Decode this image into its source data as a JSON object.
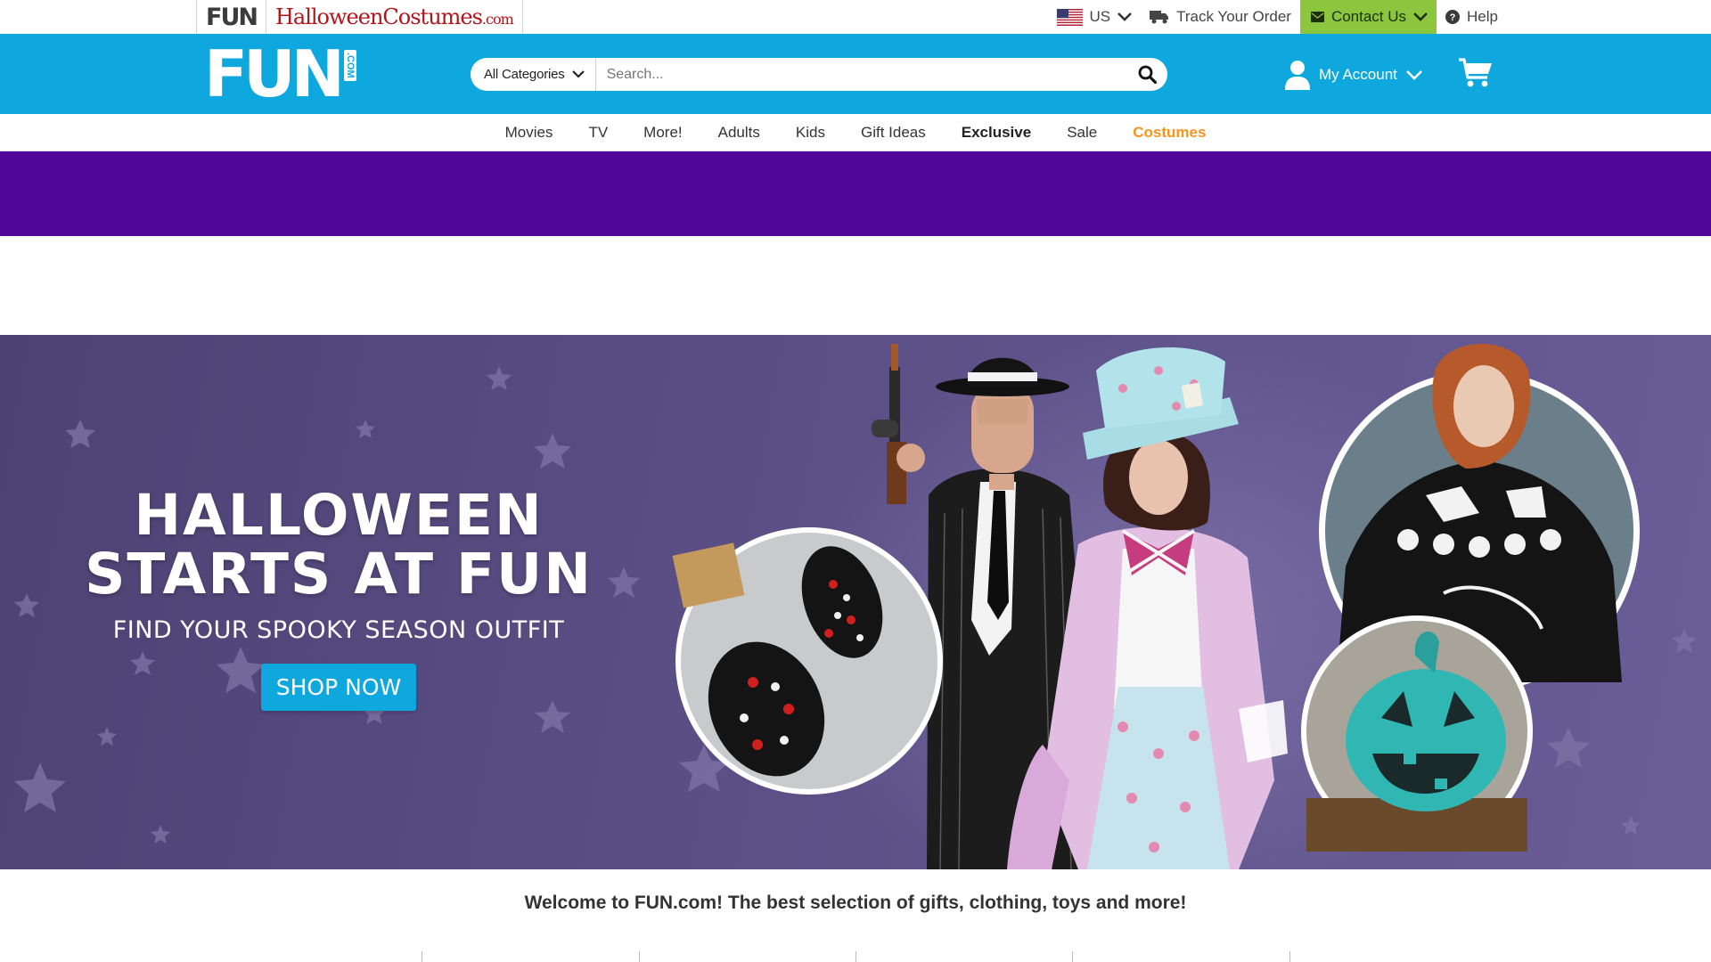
{
  "utility": {
    "sites": [
      {
        "name": "FUN"
      },
      {
        "name": "HalloweenCostumes",
        "tld": ".com"
      }
    ],
    "region": "US",
    "track_order": "Track Your Order",
    "contact": "Contact Us",
    "help": "Help"
  },
  "header": {
    "logo_text": "FUN",
    "logo_suffix": ".COM",
    "category_select": "All Categories",
    "search_placeholder": "Search...",
    "account_label": "My Account"
  },
  "nav": {
    "items": [
      "Movies",
      "TV",
      "More!",
      "Adults",
      "Kids",
      "Gift Ideas",
      "Exclusive",
      "Sale",
      "Costumes"
    ]
  },
  "hero": {
    "title_line1": "HALLOWEEN",
    "title_line2": "STARTS AT FUN",
    "subtitle": "FIND YOUR SPOOKY SEASON OUTFIT",
    "cta": "SHOP NOW"
  },
  "welcome": "Welcome to FUN.com! The best selection of gifts, clothing, toys and more!",
  "colors": {
    "header_blue": "#0ea8df",
    "promo_purple": "#51069b",
    "contact_green": "#8cc63f",
    "costumes_orange": "#f7941d",
    "hero_bg": "#5b4f86"
  },
  "icons": [
    "us-flag-icon",
    "chevron-down-icon",
    "truck-icon",
    "envelope-icon",
    "help-circle-icon",
    "search-icon",
    "user-icon",
    "cart-icon"
  ]
}
